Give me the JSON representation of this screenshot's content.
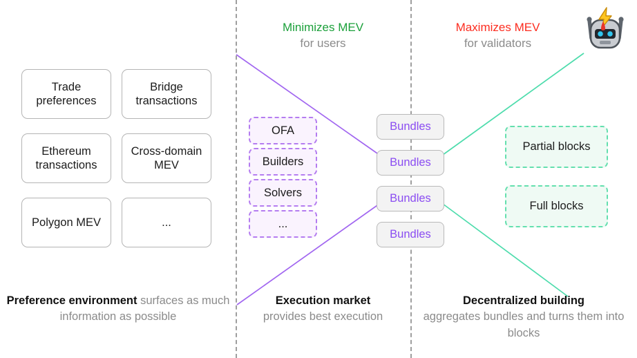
{
  "colors": {
    "purple_line": "#a166f0",
    "green_line": "#4ddcac",
    "divider": "#9e9e9e",
    "minimizes_green": "#1ba03a",
    "maximizes_red": "#fc2c1f",
    "bundle_text_purple": "#8b4df2",
    "exec_border_purple": "#b47cf0",
    "exec_fill_purple": "#faf3fe",
    "block_border_green": "#63dfae",
    "block_fill_green": "#effaf4",
    "muted_text": "#8b8b8b",
    "body_text": "#1b1b1b"
  },
  "columns": {
    "preference_environment": {
      "cards": [
        {
          "label": "Trade preferences"
        },
        {
          "label": "Bridge transactions"
        },
        {
          "label": "Ethereum transactions"
        },
        {
          "label": "Cross-domain MEV"
        },
        {
          "label": "Polygon MEV"
        },
        {
          "label": "..."
        }
      ],
      "caption_strong": "Preference environment",
      "caption_soft": " surfaces as much information as possible"
    },
    "execution_market": {
      "header_main": "Minimizes MEV",
      "header_sub": "for users",
      "cards": [
        {
          "label": "OFA"
        },
        {
          "label": "Builders"
        },
        {
          "label": "Solvers"
        },
        {
          "label": "..."
        }
      ],
      "caption_strong": "Execution market",
      "caption_soft": "provides best execution"
    },
    "bundles": {
      "items": [
        {
          "label": "Bundles"
        },
        {
          "label": "Bundles"
        },
        {
          "label": "Bundles"
        },
        {
          "label": "Bundles"
        }
      ]
    },
    "decentralized_building": {
      "header_main": "Maximizes MEV",
      "header_sub": "for validators",
      "icon": "robot-head-lightning-icon",
      "cards": [
        {
          "label": "Partial blocks"
        },
        {
          "label": "Full blocks"
        }
      ],
      "caption_strong": "Decentralized building",
      "caption_soft": "aggregates bundles and turns them into blocks"
    }
  }
}
